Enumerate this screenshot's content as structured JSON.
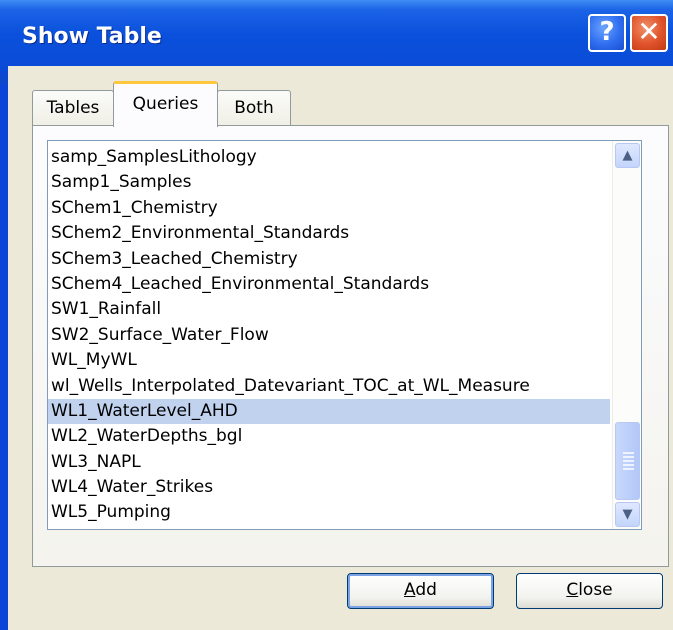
{
  "window": {
    "title": "Show Table"
  },
  "titlebar": {
    "help_glyph": "?",
    "close_glyph": "✕"
  },
  "tabs": [
    {
      "label": "Tables",
      "selected": false
    },
    {
      "label": "Queries",
      "selected": true
    },
    {
      "label": "Both",
      "selected": false
    }
  ],
  "list": {
    "items": [
      "samp_SamplesLithology",
      "Samp1_Samples",
      "SChem1_Chemistry",
      "SChem2_Environmental_Standards",
      "SChem3_Leached_Chemistry",
      "SChem4_Leached_Environmental_Standards",
      "SW1_Rainfall",
      "SW2_Surface_Water_Flow",
      "WL_MyWL",
      "wl_Wells_Interpolated_Datevariant_TOC_at_WL_Measure",
      "WL1_WaterLevel_AHD",
      "WL2_WaterDepths_bgl",
      "WL3_NAPL",
      "WL4_Water_Strikes",
      "WL5_Pumping"
    ],
    "selected_index": 10,
    "scroll_up_icon": "chevron-up-icon",
    "scroll_down_icon": "chevron-down-icon"
  },
  "buttons": {
    "add": {
      "mnemonic": "A",
      "rest": "dd"
    },
    "close": {
      "mnemonic": "C",
      "rest": "lose"
    }
  },
  "colors": {
    "titlebar": "#0a4bd6",
    "selection": "#c1d2ee",
    "active_tab_accent": "#ffc83c",
    "face": "#ece9d8"
  }
}
